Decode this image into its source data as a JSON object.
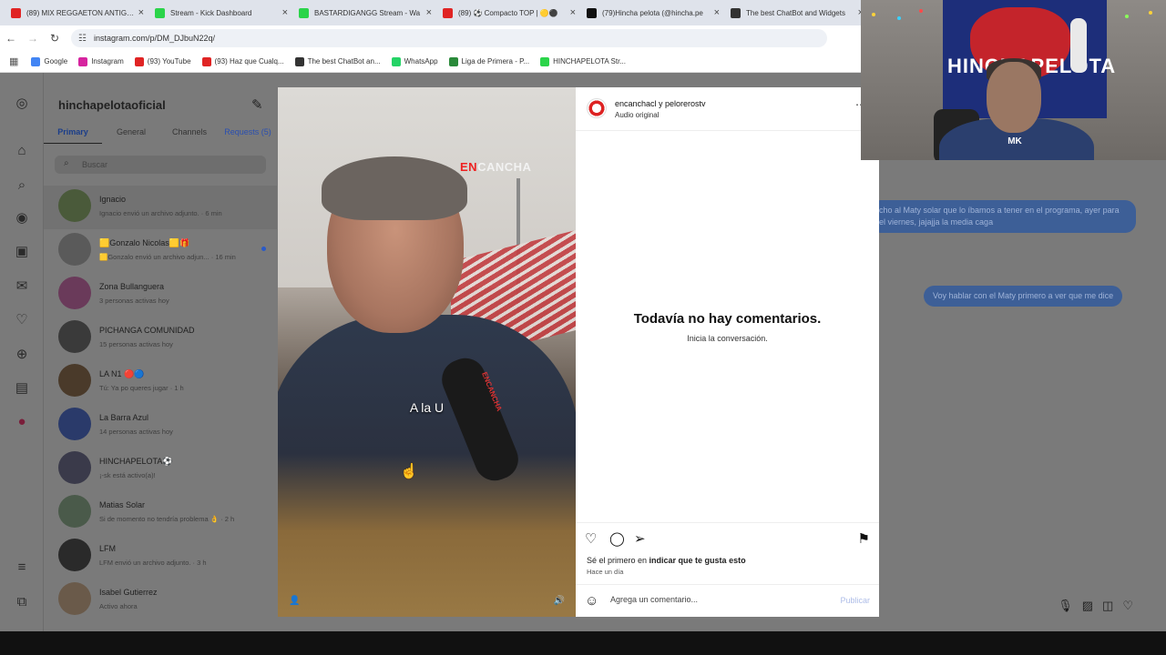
{
  "browser": {
    "tabs": [
      {
        "title": "(89) MIX REGGAETON ANTIGUO",
        "color": "#e02424"
      },
      {
        "title": "Stream - Kick Dashboard",
        "color": "#2bd44a"
      },
      {
        "title": "BASTARDIGANGG Stream - Wa",
        "color": "#2bd44a"
      },
      {
        "title": "(89) ⚽ Compacto TOP | 🟡⚫",
        "color": "#e02424"
      },
      {
        "title": "(79)Hincha pelota (@hincha.pe",
        "color": "#111111"
      },
      {
        "title": "The best ChatBot and Widgets",
        "color": "#333333"
      }
    ],
    "url": "instagram.com/p/DM_DJbuN22q/",
    "bookmarks": [
      {
        "label": "Google",
        "color": "#4285f4"
      },
      {
        "label": "Instagram",
        "color": "#d6249f"
      },
      {
        "label": "(93) YouTube",
        "color": "#e02424"
      },
      {
        "label": "(93) Haz que Cualq...",
        "color": "#e02424"
      },
      {
        "label": "The best ChatBot an...",
        "color": "#333333"
      },
      {
        "label": "WhatsApp",
        "color": "#25d366"
      },
      {
        "label": "Liga de Primera - P...",
        "color": "#2a8a3a"
      },
      {
        "label": "HINCHAPELOTA Str...",
        "color": "#2bd44a"
      }
    ]
  },
  "inbox": {
    "username": "hinchapelotaoficial",
    "tabs": [
      "Primary",
      "General",
      "Channels",
      "Requests (5)"
    ],
    "search_placeholder": "Buscar",
    "conversations": [
      {
        "name": "Ignacio",
        "sub": "Ignacio envió un archivo adjunto. · 6 min",
        "color": "#4a5a3a"
      },
      {
        "name": "🟨Gonzalo Nicolas🟨🎁",
        "sub": "🟨Gonzalo envió un archivo adjun... · 16 min",
        "color": "#5a5a5a"
      },
      {
        "name": "Zona Bullanguera",
        "sub": "3 personas activas hoy",
        "color": "#6a3a5a"
      },
      {
        "name": "PICHANGA COMUNIDAD",
        "sub": "15 personas activas hoy",
        "color": "#3a3a3a"
      },
      {
        "name": "LA N1 🔴🔵",
        "sub": "Tú: Ya po queres jugar · 1 h",
        "color": "#4a3a2a"
      },
      {
        "name": "La Barra Azul",
        "sub": "14 personas activas hoy",
        "color": "#2a3a6a"
      },
      {
        "name": "HINCHAPELOTA⚽",
        "sub": "¡-sk está activo(a)!",
        "color": "#3a3a4a"
      },
      {
        "name": "Matias Solar",
        "sub": "Si de momento no tendría problema 👌 · 2 h",
        "color": "#4a5a4a"
      },
      {
        "name": "LFM",
        "sub": "LFM envió un archivo adjunto. · 3 h",
        "color": "#2a2a2a"
      },
      {
        "name": "Isabel Gutierrez",
        "sub": "Activo ahora",
        "color": "#6a5a4a"
      }
    ]
  },
  "chat": {
    "bubble1": "cho al Maty solar que lo íbamos a tener en el programa, ayer para el viernes, jajajja la media caga",
    "bubble2": "Voy hablar con el Maty primero a ver que me dice"
  },
  "video": {
    "logo_en": "EN",
    "logo_cancha": "CANCHA",
    "caption": "A la U",
    "mic_label": "ENCANCHA"
  },
  "post": {
    "author": "encanchacl y pelorerostv",
    "audio": "Audio original",
    "no_comments": "Todavía no hay comentarios.",
    "start": "Inicia la conversación.",
    "first_like_prefix": "Sé el primero en ",
    "first_like_link": "indicar que te gusta esto",
    "ago": "Hace un día",
    "comment_placeholder": "Agrega un comentario...",
    "publish": "Publicar"
  },
  "webcam": {
    "flag_text": "HINCHAPELOTA",
    "shirt_logo": "MK"
  }
}
